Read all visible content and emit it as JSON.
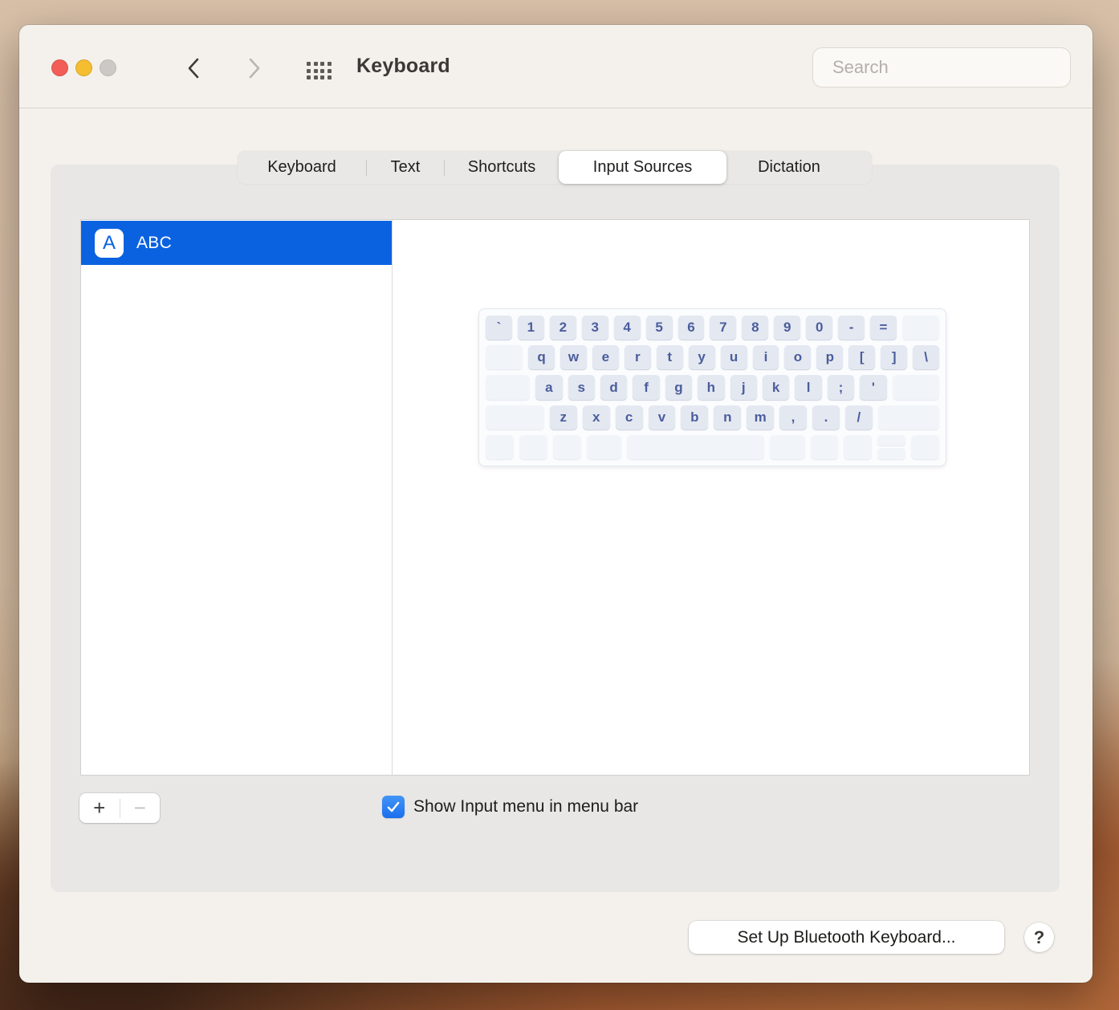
{
  "window": {
    "title": "Keyboard"
  },
  "titlebar": {
    "search_placeholder": "Search"
  },
  "tabs": [
    {
      "label": "Keyboard",
      "selected": false
    },
    {
      "label": "Text",
      "selected": false
    },
    {
      "label": "Shortcuts",
      "selected": false
    },
    {
      "label": "Input Sources",
      "selected": true
    },
    {
      "label": "Dictation",
      "selected": false
    }
  ],
  "input_sources": {
    "items": [
      {
        "label": "ABC",
        "icon_letter": "A",
        "selected": true
      }
    ]
  },
  "keyboard_preview": {
    "rows": [
      [
        {
          "t": "`",
          "u": 1
        },
        {
          "t": "1",
          "u": 1
        },
        {
          "t": "2",
          "u": 1
        },
        {
          "t": "3",
          "u": 1
        },
        {
          "t": "4",
          "u": 1
        },
        {
          "t": "5",
          "u": 1
        },
        {
          "t": "6",
          "u": 1
        },
        {
          "t": "7",
          "u": 1
        },
        {
          "t": "8",
          "u": 1
        },
        {
          "t": "9",
          "u": 1
        },
        {
          "t": "0",
          "u": 1
        },
        {
          "t": "-",
          "u": 1
        },
        {
          "t": "=",
          "u": 1
        },
        {
          "t": "",
          "u": 1.4
        }
      ],
      [
        {
          "t": "",
          "u": 1.4
        },
        {
          "t": "q",
          "u": 1
        },
        {
          "t": "w",
          "u": 1
        },
        {
          "t": "e",
          "u": 1
        },
        {
          "t": "r",
          "u": 1
        },
        {
          "t": "t",
          "u": 1
        },
        {
          "t": "y",
          "u": 1
        },
        {
          "t": "u",
          "u": 1
        },
        {
          "t": "i",
          "u": 1
        },
        {
          "t": "o",
          "u": 1
        },
        {
          "t": "p",
          "u": 1
        },
        {
          "t": "[",
          "u": 1
        },
        {
          "t": "]",
          "u": 1
        },
        {
          "t": "\\",
          "u": 1
        }
      ],
      [
        {
          "t": "",
          "u": 1.65
        },
        {
          "t": "a",
          "u": 1
        },
        {
          "t": "s",
          "u": 1
        },
        {
          "t": "d",
          "u": 1
        },
        {
          "t": "f",
          "u": 1
        },
        {
          "t": "g",
          "u": 1
        },
        {
          "t": "h",
          "u": 1
        },
        {
          "t": "j",
          "u": 1
        },
        {
          "t": "k",
          "u": 1
        },
        {
          "t": "l",
          "u": 1
        },
        {
          "t": ";",
          "u": 1
        },
        {
          "t": "'",
          "u": 1
        },
        {
          "t": "",
          "u": 1.75
        }
      ],
      [
        {
          "t": "",
          "u": 2.15
        },
        {
          "t": "z",
          "u": 1
        },
        {
          "t": "x",
          "u": 1
        },
        {
          "t": "c",
          "u": 1
        },
        {
          "t": "v",
          "u": 1
        },
        {
          "t": "b",
          "u": 1
        },
        {
          "t": "n",
          "u": 1
        },
        {
          "t": "m",
          "u": 1
        },
        {
          "t": ",",
          "u": 1
        },
        {
          "t": ".",
          "u": 1
        },
        {
          "t": "/",
          "u": 1
        },
        {
          "t": "",
          "u": 2.25
        }
      ],
      [
        {
          "t": "",
          "u": 1
        },
        {
          "t": "",
          "u": 1
        },
        {
          "t": "",
          "u": 1
        },
        {
          "t": "",
          "u": 1.25
        },
        {
          "t": "",
          "u": 4.9
        },
        {
          "t": "",
          "u": 1.25
        },
        {
          "t": "",
          "u": 1
        },
        {
          "t": "",
          "u": 1
        },
        {
          "split": true,
          "u": 1
        },
        {
          "t": "",
          "u": 1
        }
      ]
    ]
  },
  "footer": {
    "add_label": "+",
    "remove_label": "−",
    "checkbox_label": "Show Input menu in menu bar",
    "checkbox_checked": true
  },
  "actions": {
    "bluetooth_button_label": "Set Up Bluetooth Keyboard...",
    "help_button_label": "?"
  },
  "colors": {
    "selection_blue": "#0a62e1",
    "checkbox_blue": "#1a6fee",
    "key_text": "#4b5d9c",
    "traffic_red": "#f25e57",
    "traffic_yellow": "#f5bd30",
    "traffic_gray": "#cbc9c6"
  }
}
